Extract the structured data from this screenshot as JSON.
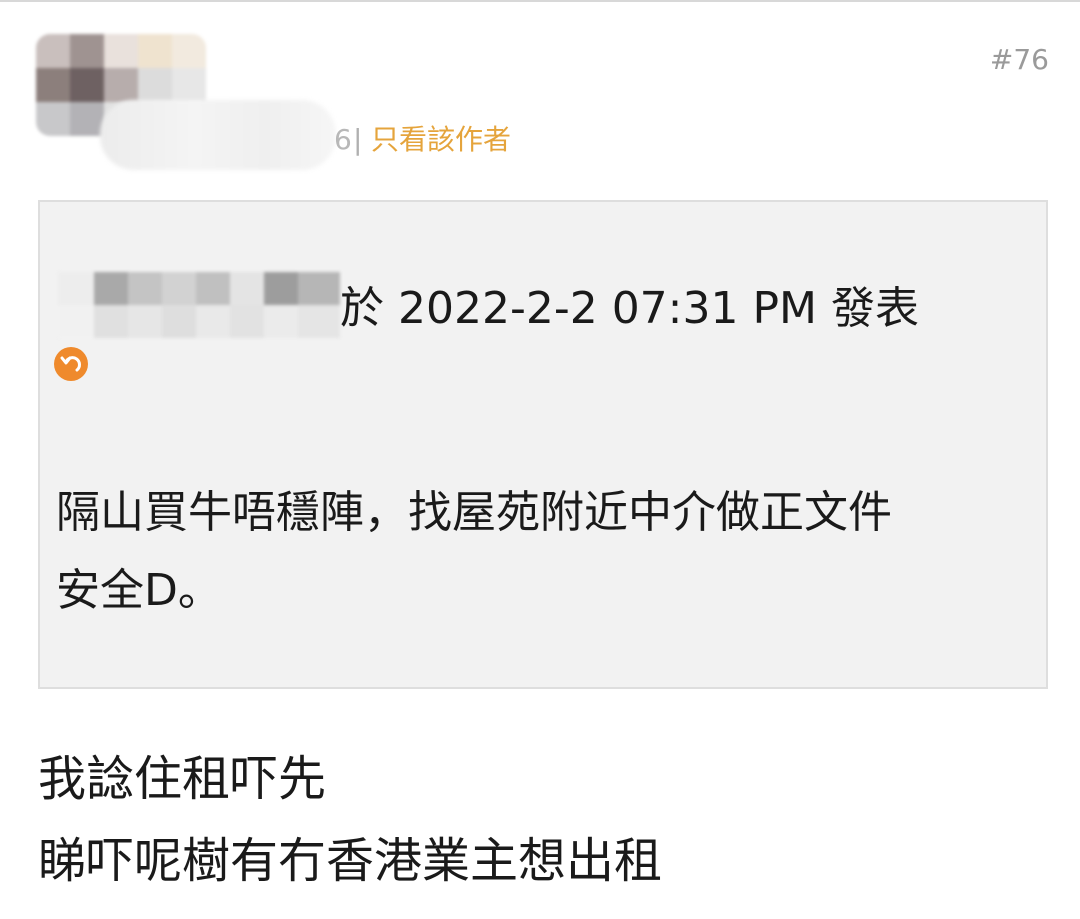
{
  "post": {
    "floor_number": "#76",
    "author": {
      "name_tail": "6",
      "separator": "|",
      "only_author_link": "只看該作者"
    },
    "quote": {
      "meta": "於 2022-2-2 07:31 PM 發表",
      "body_lines": [
        "隔山買牛唔穩陣，找屋苑附近中介做正文件",
        "安全D。"
      ],
      "back_icon": "reply-arrow-icon"
    },
    "reply_lines": [
      "我諗住租吓先",
      "睇吓呢樹有冇香港業主想出租"
    ]
  },
  "colors": {
    "accent": "#e5a43c",
    "icon_orange": "#ef8a2c",
    "quote_bg": "#f2f2f2",
    "muted": "#9a9a9a"
  }
}
